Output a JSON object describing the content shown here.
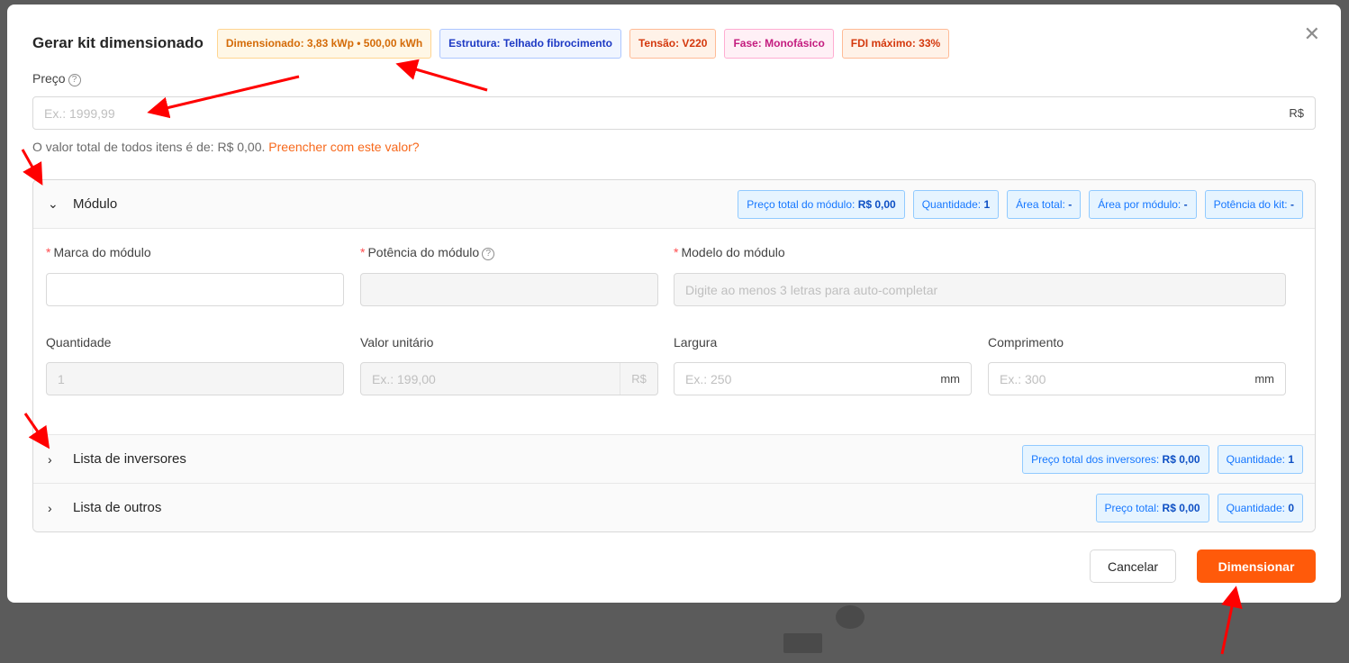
{
  "modal": {
    "title": "Gerar kit dimensionado",
    "close_icon": "close-icon",
    "tags": [
      {
        "text": "Dimensionado: 3,83 kWp • 500,00 kWh",
        "color": "#d46b08",
        "bg": "#fff7e6",
        "border": "#ffd591"
      },
      {
        "text": "Estrutura: Telhado fibrocimento",
        "color": "#1d39c4",
        "bg": "#f0f5ff",
        "border": "#adc6ff"
      },
      {
        "text": "Tensão: V220",
        "color": "#d4380d",
        "bg": "#fff2e8",
        "border": "#ffbb96"
      },
      {
        "text": "Fase: Monofásico",
        "color": "#c41d7f",
        "bg": "#fff0f6",
        "border": "#ffadd2"
      },
      {
        "text": "FDI máximo: 33%",
        "color": "#d4380d",
        "bg": "#fff2e8",
        "border": "#ffbb96"
      }
    ]
  },
  "price": {
    "label": "Preço",
    "placeholder": "Ex.: 1999,99",
    "suffix": "R$",
    "hint_text": "O valor total de todos itens é de: R$ 0,00.",
    "hint_link": "Preencher com este valor?"
  },
  "module": {
    "title": "Módulo",
    "badges": [
      {
        "label": "Preço total do módulo:",
        "value": "R$ 0,00"
      },
      {
        "label": "Quantidade:",
        "value": "1"
      },
      {
        "label": "Área total:",
        "value": "-"
      },
      {
        "label": "Área por módulo:",
        "value": "-"
      },
      {
        "label": "Potência do kit:",
        "value": "-"
      }
    ],
    "fields": {
      "brand_label": "Marca do módulo",
      "power_label": "Potência do módulo",
      "model_label": "Modelo do módulo",
      "model_placeholder": "Digite ao menos 3 letras para auto-completar",
      "quantity_label": "Quantidade",
      "quantity_value": "1",
      "unit_value_label": "Valor unitário",
      "unit_value_placeholder": "Ex.: 199,00",
      "unit_value_suffix": "R$",
      "width_label": "Largura",
      "width_placeholder": "Ex.: 250",
      "width_suffix": "mm",
      "length_label": "Comprimento",
      "length_placeholder": "Ex.: 300",
      "length_suffix": "mm"
    }
  },
  "inverters": {
    "title": "Lista de inversores",
    "badges": [
      {
        "label": "Preço total dos inversores:",
        "value": "R$ 0,00"
      },
      {
        "label": "Quantidade:",
        "value": "1"
      }
    ]
  },
  "others": {
    "title": "Lista de outros",
    "badges": [
      {
        "label": "Preço total:",
        "value": "R$ 0,00"
      },
      {
        "label": "Quantidade:",
        "value": "0"
      }
    ]
  },
  "footer": {
    "cancel_label": "Cancelar",
    "submit_label": "Dimensionar"
  },
  "colors": {
    "accent": "#ff5a0a",
    "annotation_arrow": "#ff0000"
  }
}
